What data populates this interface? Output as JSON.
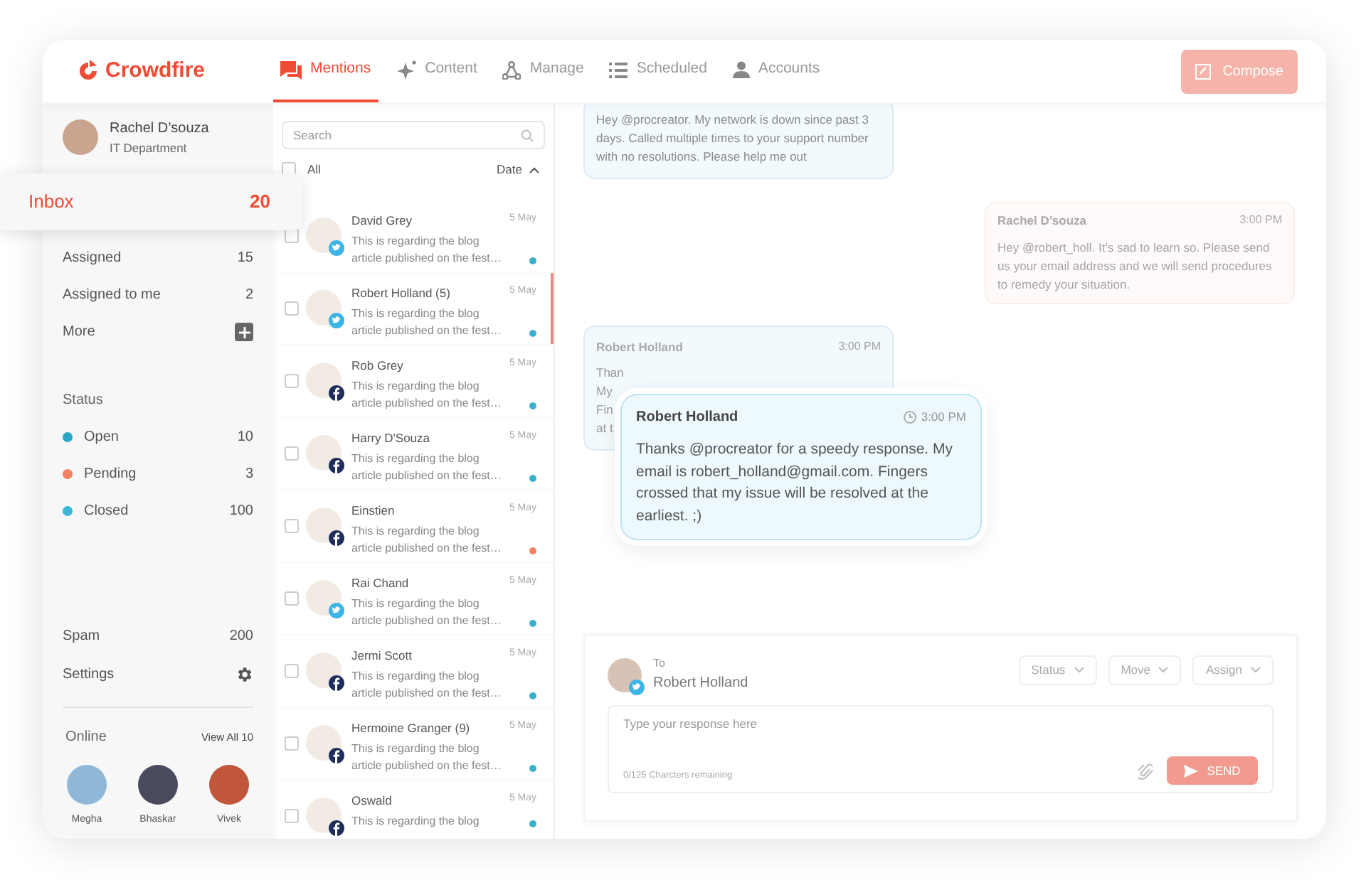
{
  "logo": "Crowdfire",
  "nav": [
    {
      "label": "Mentions",
      "selected": true
    },
    {
      "label": "Content",
      "selected": false
    },
    {
      "label": "Manage",
      "selected": false
    },
    {
      "label": "Scheduled",
      "selected": false
    },
    {
      "label": "Accounts",
      "selected": false
    }
  ],
  "compose_button": "Compose",
  "user": {
    "name": "Rachel D’souza",
    "department": "IT Department"
  },
  "inbox": {
    "label": "Inbox",
    "count": "20",
    "selected": true
  },
  "folders": [
    {
      "label": "Assigned",
      "count": "15"
    },
    {
      "label": "Assigned to me",
      "count": "2"
    }
  ],
  "more": "More",
  "status": {
    "heading": "Status",
    "items": [
      {
        "label": "Open",
        "count": "10",
        "color": "#2aa6c6"
      },
      {
        "label": "Pending",
        "count": "3",
        "color": "#f5825f"
      },
      {
        "label": "Closed",
        "count": "100",
        "color": "#3bb6d8"
      }
    ]
  },
  "spam": {
    "label": "Spam",
    "count": "200"
  },
  "settings": "Settings",
  "online": {
    "heading": "Online",
    "view_all": "View All 10",
    "people": [
      "Megha",
      "Bhaskar",
      "Vivek"
    ]
  },
  "search": {
    "placeholder": "Search"
  },
  "select_all": {
    "label": "All",
    "checked": false
  },
  "sort": "Date",
  "conversations": [
    {
      "name": "David Grey",
      "date": "5 May",
      "kind": "twitter",
      "preview": [
        "This is regarding the blog",
        "article published on the fest…"
      ],
      "color": "#3ab0d0",
      "selected": false
    },
    {
      "name": "Robert Holland (5)",
      "date": "5 May",
      "kind": "twitter",
      "preview": [
        "This is regarding the blog",
        "article published on the fest…"
      ],
      "color": "#3ab0d0",
      "selected": true
    },
    {
      "name": "Rob Grey",
      "date": "5 May",
      "kind": "facebook",
      "preview": [
        "This is regarding the blog",
        "article published on the fest…"
      ],
      "color": "#3ab0d0",
      "selected": false
    },
    {
      "name": "Harry D'Souza",
      "date": "5 May",
      "kind": "facebook",
      "preview": [
        "This is regarding the blog",
        "article published on the fest…"
      ],
      "color": "#3ab0d0",
      "selected": false
    },
    {
      "name": "Einstien",
      "date": "5 May",
      "kind": "facebook",
      "preview": [
        "This is regarding the blog",
        "article published on the fest…"
      ],
      "color": "#f5825f",
      "selected": false
    },
    {
      "name": "Rai Chand",
      "date": "5 May",
      "kind": "twitter",
      "preview": [
        "This is regarding the blog",
        "article published on the fest…"
      ],
      "color": "#3ab0d0",
      "selected": false
    },
    {
      "name": "Jermi Scott",
      "date": "5 May",
      "kind": "facebook",
      "preview": [
        "This is regarding the blog",
        "article published on the fest…"
      ],
      "color": "#3ab0d0",
      "selected": false
    },
    {
      "name": "Hermoine Granger (9)",
      "date": "5 May",
      "kind": "facebook",
      "preview": [
        "This is regarding the blog",
        "article published on the fest…"
      ],
      "color": "#3ab0d0",
      "selected": false
    },
    {
      "name": "Oswald",
      "date": "5 May",
      "kind": "facebook",
      "preview": [
        "This is regarding the blog"
      ],
      "color": "#3ab0d0",
      "selected": false
    }
  ],
  "messages": [
    {
      "kind": "incoming",
      "text": "Hey @procreator. My network is down since past 3 days. Called multiple times to your support number with no resolutions. Please help me out"
    },
    {
      "kind": "outgoing",
      "author": "Rachel D’souza",
      "time": "3:00 PM",
      "text": "Hey @robert_holl. It's sad to learn so. Please send us your email address and we will send procedures to remedy your situation."
    },
    {
      "kind": "covered",
      "author": "Robert Holland",
      "time": "3:00 PM",
      "lines": [
        "Than",
        "My",
        "Fin",
        "at t"
      ]
    },
    {
      "kind": "popup",
      "author": "Robert Holland",
      "time": "3:00 PM",
      "text": "Thanks @procreator for a speedy response. My email is robert_holland@gmail.com. Fingers crossed that my issue will be resolved at the earliest. ;)"
    }
  ],
  "reply": {
    "to_label": "To",
    "recipient": "Robert Holland",
    "kind": "twitter",
    "actions": [
      "Status",
      "Move",
      "Assign"
    ],
    "placeholder": "Type your response here",
    "counter": "0/125 Charcters remaining",
    "send": "SEND"
  }
}
